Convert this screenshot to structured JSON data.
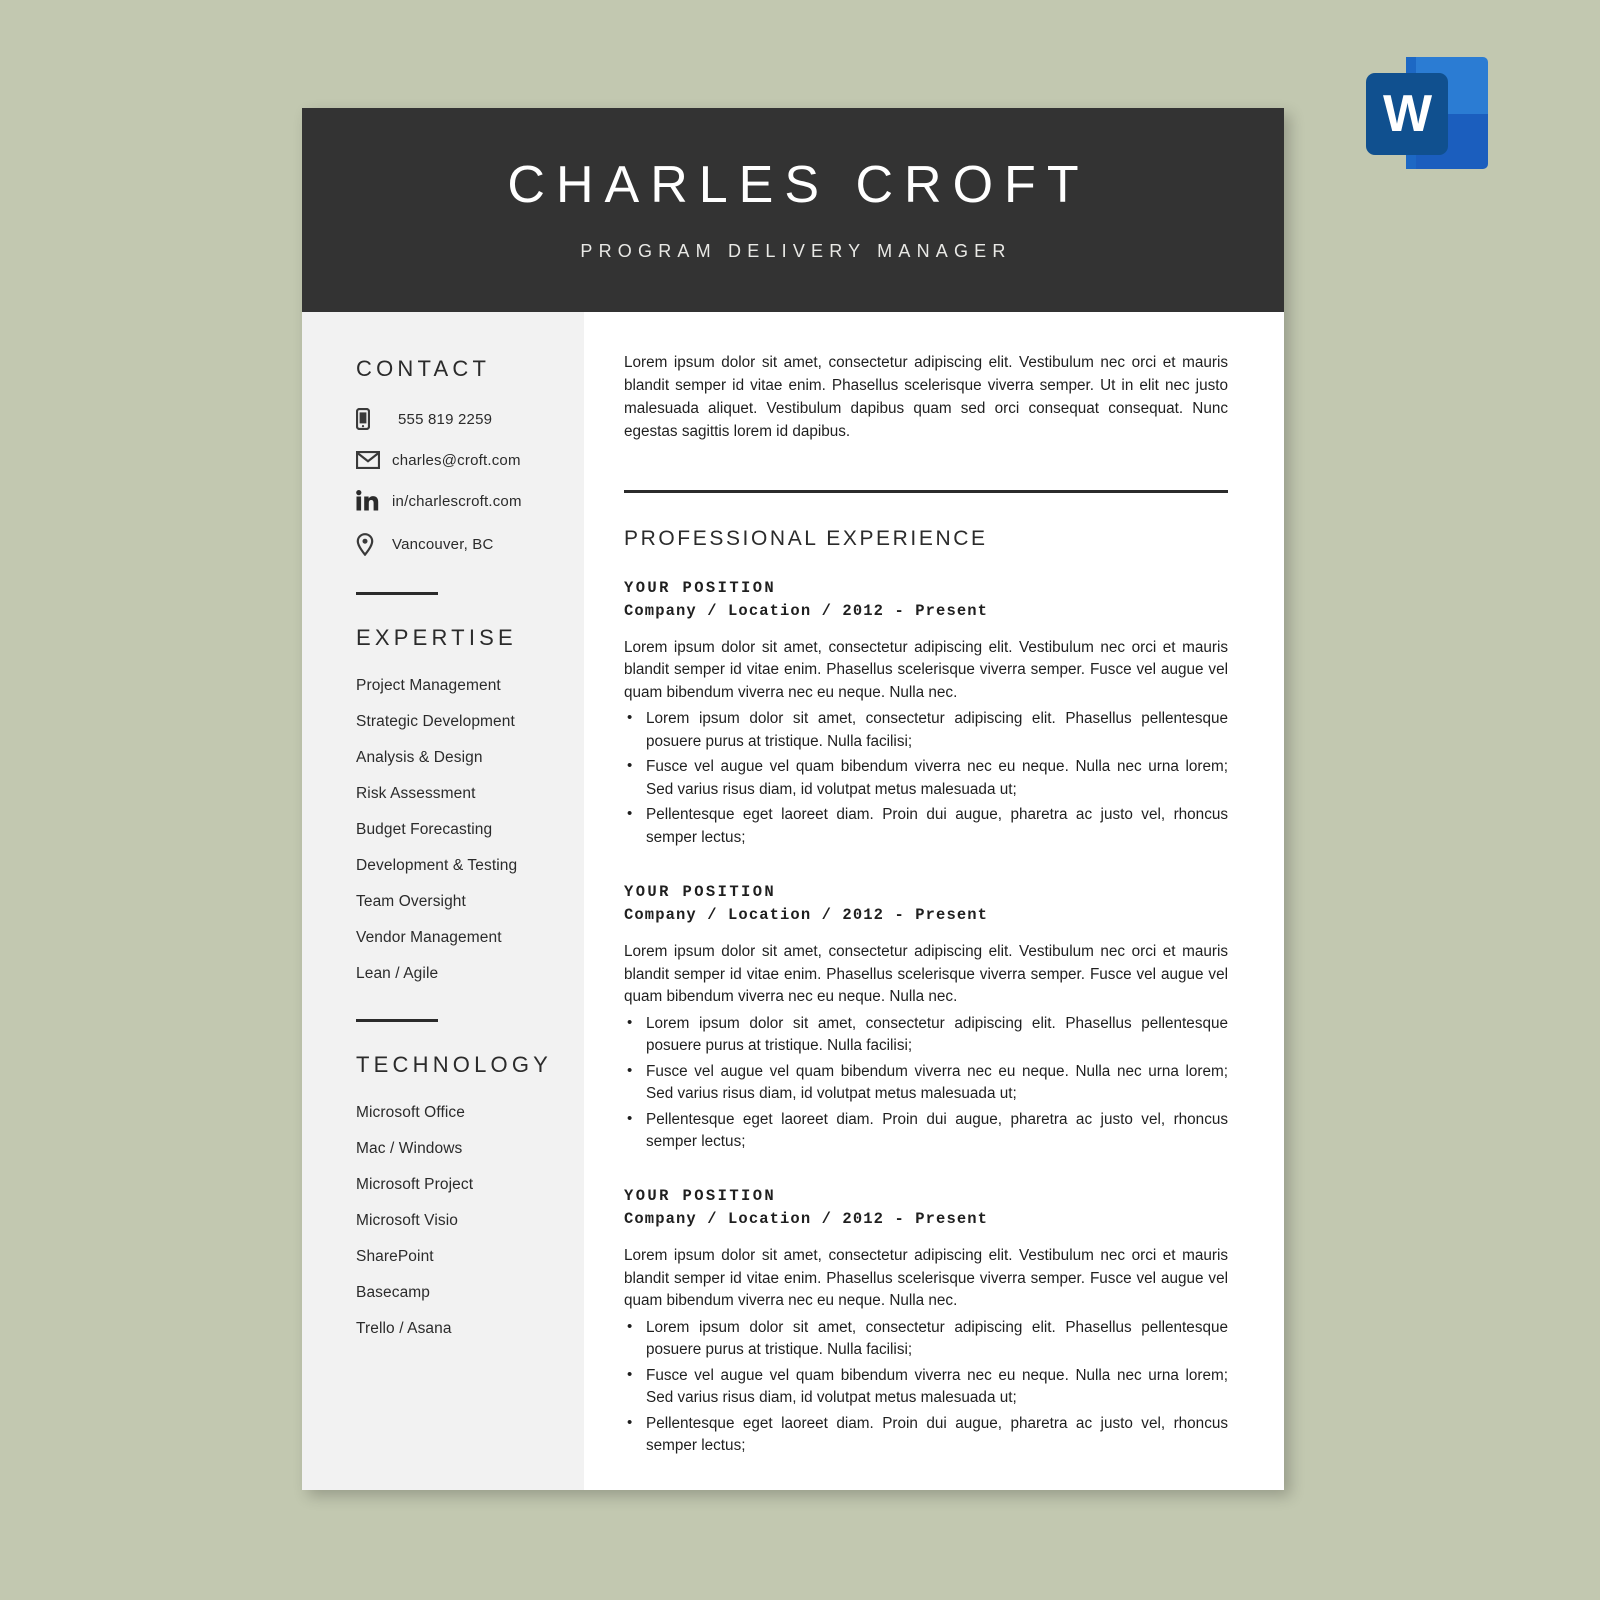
{
  "app_icon": {
    "name": "microsoft-word-icon",
    "letter": "W",
    "colors": {
      "tile": "#10508f",
      "sheet_top": "#2b7cd3",
      "sheet_bottom": "#1b5ebe"
    }
  },
  "theme": {
    "background": "#c2c8b0",
    "header_bg": "#333333",
    "sidebar_bg": "#f2f2f2",
    "page_bg": "#ffffff",
    "text": "#1f1f1f"
  },
  "header": {
    "name": "CHARLES CROFT",
    "title": "PROGRAM DELIVERY MANAGER"
  },
  "sidebar": {
    "contact": {
      "heading": "CONTACT",
      "items": [
        {
          "icon": "phone-icon",
          "value": "555 819 2259"
        },
        {
          "icon": "email-icon",
          "value": "charles@croft.com"
        },
        {
          "icon": "linkedin-icon",
          "value": "in/charlescroft.com"
        },
        {
          "icon": "location-pin-icon",
          "value": "Vancouver, BC"
        }
      ]
    },
    "expertise": {
      "heading": "EXPERTISE",
      "items": [
        "Project Management",
        "Strategic Development",
        "Analysis & Design",
        "Risk Assessment",
        "Budget Forecasting",
        "Development & Testing",
        "Team Oversight",
        "Vendor Management",
        "Lean / Agile"
      ]
    },
    "technology": {
      "heading": "TECHNOLOGY",
      "items": [
        "Microsoft Office",
        "Mac / Windows",
        "Microsoft Project",
        "Microsoft Visio",
        "SharePoint",
        "Basecamp",
        "Trello / Asana"
      ]
    }
  },
  "main": {
    "summary": "Lorem ipsum dolor sit amet, consectetur adipiscing elit. Vestibulum nec orci et mauris blandit semper id vitae enim. Phasellus scelerisque viverra semper. Ut in elit nec justo malesuada aliquet. Vestibulum dapibus quam sed orci consequat consequat. Nunc egestas sagittis lorem id dapibus.",
    "experience_heading": "PROFESSIONAL EXPERIENCE",
    "jobs": [
      {
        "position": "YOUR POSITION",
        "meta": "Company / Location / 2012 - Present",
        "description": "Lorem ipsum dolor sit amet, consectetur adipiscing elit. Vestibulum nec orci et mauris blandit semper id vitae enim. Phasellus scelerisque viverra semper.  Fusce vel augue vel quam bibendum viverra nec eu neque. Nulla nec.",
        "bullets": [
          "Lorem ipsum dolor sit amet, consectetur adipiscing elit. Phasellus pellentesque posuere purus at tristique. Nulla facilisi;",
          "Fusce vel augue vel quam bibendum viverra nec eu neque. Nulla nec urna lorem; Sed varius risus diam, id volutpat metus malesuada ut;",
          "Pellentesque eget laoreet diam. Proin dui augue, pharetra ac justo vel, rhoncus semper lectus;"
        ]
      },
      {
        "position": "YOUR POSITION",
        "meta": "Company / Location / 2012 - Present",
        "description": "Lorem ipsum dolor sit amet, consectetur adipiscing elit. Vestibulum nec orci et mauris blandit semper id vitae enim. Phasellus scelerisque viverra semper.  Fusce vel augue vel quam bibendum viverra nec eu neque. Nulla nec.",
        "bullets": [
          "Lorem ipsum dolor sit amet, consectetur adipiscing elit. Phasellus pellentesque posuere purus at tristique. Nulla facilisi;",
          "Fusce vel augue vel quam bibendum viverra nec eu neque. Nulla nec urna lorem; Sed varius risus diam, id volutpat metus malesuada ut;",
          "Pellentesque eget laoreet diam. Proin dui augue, pharetra ac justo vel, rhoncus semper lectus;"
        ]
      },
      {
        "position": "YOUR POSITION",
        "meta": "Company / Location / 2012 - Present",
        "description": "Lorem ipsum dolor sit amet, consectetur adipiscing elit. Vestibulum nec orci et mauris blandit semper id vitae enim. Phasellus scelerisque viverra semper.  Fusce vel augue vel quam bibendum viverra nec eu neque. Nulla nec.",
        "bullets": [
          "Lorem ipsum dolor sit amet, consectetur adipiscing elit. Phasellus pellentesque posuere purus at tristique. Nulla facilisi;",
          "Fusce vel augue vel quam bibendum viverra nec eu neque. Nulla nec urna lorem; Sed varius risus diam, id volutpat metus malesuada ut;",
          "Pellentesque eget laoreet diam. Proin dui augue, pharetra ac justo vel, rhoncus semper lectus;"
        ]
      }
    ]
  }
}
